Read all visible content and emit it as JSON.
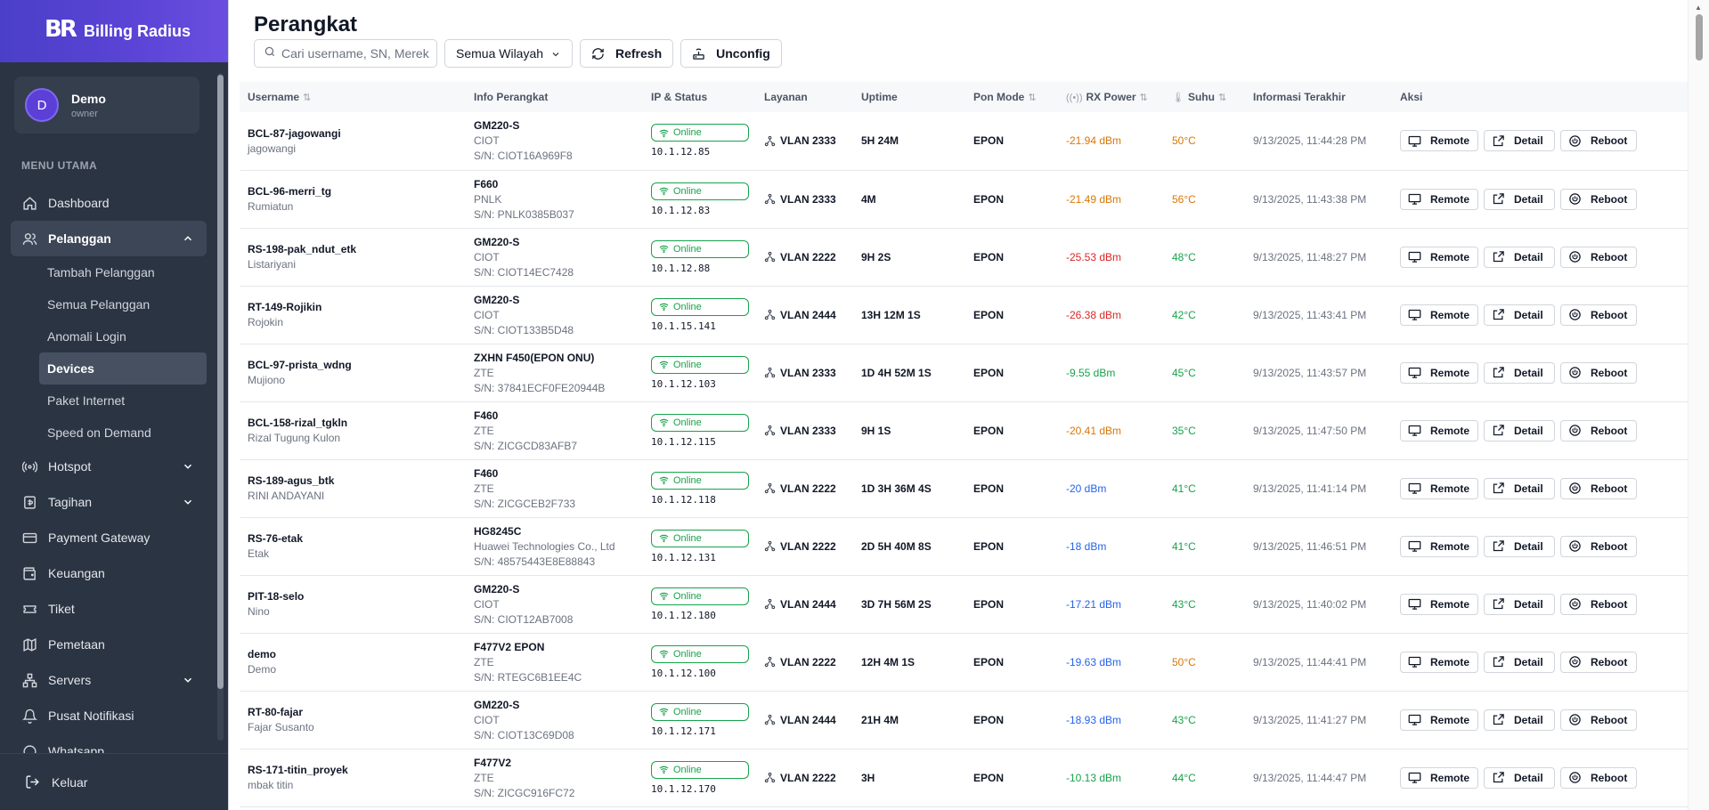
{
  "brand": {
    "logo": "BR",
    "name": "Billing Radius"
  },
  "user": {
    "initial": "D",
    "name": "Demo",
    "role": "owner"
  },
  "menu": {
    "title": "MENU UTAMA",
    "items": {
      "dashboard": "Dashboard",
      "pelanggan": "Pelanggan",
      "hotspot": "Hotspot",
      "tagihan": "Tagihan",
      "payment_gateway": "Payment Gateway",
      "keuangan": "Keuangan",
      "tiket": "Tiket",
      "pemetaan": "Pemetaan",
      "servers": "Servers",
      "pusat_notifikasi": "Pusat Notifikasi",
      "whatsapp": "Whatsapp"
    },
    "pelanggan_sub": {
      "tambah": "Tambah Pelanggan",
      "semua": "Semua Pelanggan",
      "anomali": "Anomali Login",
      "devices": "Devices",
      "paket": "Paket Internet",
      "speed": "Speed on Demand"
    },
    "logout": "Keluar"
  },
  "page": {
    "title": "Perangkat",
    "search_placeholder": "Cari username, SN, Merek",
    "region_select": "Semua Wilayah",
    "refresh_label": "Refresh",
    "unconfig_label": "Unconfig"
  },
  "table": {
    "headers": {
      "username": "Username",
      "info": "Info Perangkat",
      "ip_status": "IP & Status",
      "layanan": "Layanan",
      "uptime": "Uptime",
      "pon_mode": "Pon Mode",
      "rx_power": "RX Power",
      "suhu": "Suhu",
      "informasi": "Informasi Terakhir",
      "aksi": "Aksi"
    },
    "action_labels": {
      "remote": "Remote",
      "detail": "Detail",
      "reboot": "Reboot"
    },
    "status_colors": {
      "online": "#16a34a",
      "orange": "#d97706",
      "red": "#dc2626",
      "green": "#16a34a",
      "blue": "#2563eb"
    },
    "rows": [
      {
        "username": "BCL-87-jagowangi",
        "fullname": "jagowangi",
        "model": "GM220-S",
        "brand": "CIOT",
        "sn": "S/N: CIOT16A969F8",
        "status": "Online",
        "ip": "10.1.12.85",
        "vlan": "VLAN 2333",
        "uptime": "5H 24M",
        "pon": "EPON",
        "rx": "-21.94 dBm",
        "rx_color": "orange",
        "temp": "50°C",
        "temp_color": "orange",
        "last": "9/13/2025, 11:44:28 PM"
      },
      {
        "username": "BCL-96-merri_tg",
        "fullname": "Rumiatun",
        "model": "F660",
        "brand": "PNLK",
        "sn": "S/N: PNLK0385B037",
        "status": "Online",
        "ip": "10.1.12.83",
        "vlan": "VLAN 2333",
        "uptime": "4M",
        "pon": "EPON",
        "rx": "-21.49 dBm",
        "rx_color": "orange",
        "temp": "56°C",
        "temp_color": "orange",
        "last": "9/13/2025, 11:43:38 PM"
      },
      {
        "username": "RS-198-pak_ndut_etk",
        "fullname": "Listariyani",
        "model": "GM220-S",
        "brand": "CIOT",
        "sn": "S/N: CIOT14EC7428",
        "status": "Online",
        "ip": "10.1.12.88",
        "vlan": "VLAN 2222",
        "uptime": "9H 2S",
        "pon": "EPON",
        "rx": "-25.53 dBm",
        "rx_color": "red",
        "temp": "48°C",
        "temp_color": "green",
        "last": "9/13/2025, 11:48:27 PM"
      },
      {
        "username": "RT-149-Rojikin",
        "fullname": "Rojokin",
        "model": "GM220-S",
        "brand": "CIOT",
        "sn": "S/N: CIOT133B5D48",
        "status": "Online",
        "ip": "10.1.15.141",
        "vlan": "VLAN 2444",
        "uptime": "13H 12M 1S",
        "pon": "EPON",
        "rx": "-26.38 dBm",
        "rx_color": "red",
        "temp": "42°C",
        "temp_color": "green",
        "last": "9/13/2025, 11:43:41 PM"
      },
      {
        "username": "BCL-97-prista_wdng",
        "fullname": "Mujiono",
        "model": "ZXHN F450(EPON ONU)",
        "brand": "ZTE",
        "sn": "S/N: 37841ECF0FE20944B",
        "status": "Online",
        "ip": "10.1.12.103",
        "vlan": "VLAN 2333",
        "uptime": "1D 4H 52M 1S",
        "pon": "EPON",
        "rx": "-9.55 dBm",
        "rx_color": "green",
        "temp": "45°C",
        "temp_color": "green",
        "last": "9/13/2025, 11:43:57 PM"
      },
      {
        "username": "BCL-158-rizal_tgkln",
        "fullname": "Rizal Tugung Kulon",
        "model": "F460",
        "brand": "ZTE",
        "sn": "S/N: ZICGCD83AFB7",
        "status": "Online",
        "ip": "10.1.12.115",
        "vlan": "VLAN 2333",
        "uptime": "9H 1S",
        "pon": "EPON",
        "rx": "-20.41 dBm",
        "rx_color": "orange",
        "temp": "35°C",
        "temp_color": "green",
        "last": "9/13/2025, 11:47:50 PM"
      },
      {
        "username": "RS-189-agus_btk",
        "fullname": "RINI ANDAYANI",
        "model": "F460",
        "brand": "ZTE",
        "sn": "S/N: ZICGCEB2F733",
        "status": "Online",
        "ip": "10.1.12.118",
        "vlan": "VLAN 2222",
        "uptime": "1D 3H 36M 4S",
        "pon": "EPON",
        "rx": "-20 dBm",
        "rx_color": "blue",
        "temp": "41°C",
        "temp_color": "green",
        "last": "9/13/2025, 11:41:14 PM"
      },
      {
        "username": "RS-76-etak",
        "fullname": "Etak",
        "model": "HG8245C",
        "brand": "Huawei Technologies Co., Ltd",
        "sn": "S/N: 48575443E8E88843",
        "status": "Online",
        "ip": "10.1.12.131",
        "vlan": "VLAN 2222",
        "uptime": "2D 5H 40M 8S",
        "pon": "EPON",
        "rx": "-18 dBm",
        "rx_color": "blue",
        "temp": "41°C",
        "temp_color": "green",
        "last": "9/13/2025, 11:46:51 PM"
      },
      {
        "username": "PIT-18-selo",
        "fullname": "Nino",
        "model": "GM220-S",
        "brand": "CIOT",
        "sn": "S/N: CIOT12AB7008",
        "status": "Online",
        "ip": "10.1.12.180",
        "vlan": "VLAN 2444",
        "uptime": "3D 7H 56M 2S",
        "pon": "EPON",
        "rx": "-17.21 dBm",
        "rx_color": "blue",
        "temp": "43°C",
        "temp_color": "green",
        "last": "9/13/2025, 11:40:02 PM"
      },
      {
        "username": "demo",
        "fullname": "Demo",
        "model": "F477V2 EPON",
        "brand": "ZTE",
        "sn": "S/N: RTEGC6B1EE4C",
        "status": "Online",
        "ip": "10.1.12.100",
        "vlan": "VLAN 2222",
        "uptime": "12H 4M 1S",
        "pon": "EPON",
        "rx": "-19.63 dBm",
        "rx_color": "blue",
        "temp": "50°C",
        "temp_color": "orange",
        "last": "9/13/2025, 11:44:41 PM"
      },
      {
        "username": "RT-80-fajar",
        "fullname": "Fajar Susanto",
        "model": "GM220-S",
        "brand": "CIOT",
        "sn": "S/N: CIOT13C69D08",
        "status": "Online",
        "ip": "10.1.12.171",
        "vlan": "VLAN 2444",
        "uptime": "21H 4M",
        "pon": "EPON",
        "rx": "-18.93 dBm",
        "rx_color": "blue",
        "temp": "43°C",
        "temp_color": "green",
        "last": "9/13/2025, 11:41:27 PM"
      },
      {
        "username": "RS-171-titin_proyek",
        "fullname": "mbak titin",
        "model": "F477V2",
        "brand": "ZTE",
        "sn": "S/N: ZICGC916FC72",
        "status": "Online",
        "ip": "10.1.12.170",
        "vlan": "VLAN 2222",
        "uptime": "3H",
        "pon": "EPON",
        "rx": "-10.13 dBm",
        "rx_color": "green",
        "temp": "44°C",
        "temp_color": "green",
        "last": "9/13/2025, 11:44:47 PM"
      }
    ]
  }
}
